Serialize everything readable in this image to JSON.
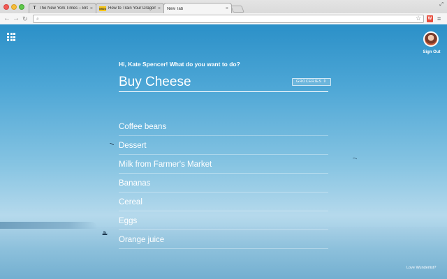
{
  "browser": {
    "tabs": [
      {
        "title": "The New York Times – Bre",
        "favicon": "T",
        "active": false
      },
      {
        "title": "How to Train Your Dragon",
        "favicon": "IMDb",
        "active": false
      },
      {
        "title": "New Tab",
        "favicon": "",
        "active": true
      }
    ],
    "address": {
      "value": ""
    },
    "extension_label": "W"
  },
  "app": {
    "greeting": "Hi, Kate Spencer! What do you want to do?",
    "task_input": {
      "value": "Buy Cheese"
    },
    "list_badge": "GROCERIES ⇕",
    "sign_out": "Sign Out",
    "footer_link": "Love Wunderlist?",
    "todos": [
      "Coffee beans",
      "Dessert",
      "Milk from Farmer's Market",
      "Bananas",
      "Cereal",
      "Eggs",
      "Orange juice"
    ]
  },
  "colors": {
    "sky_top": "#2b90c8",
    "sky_bottom": "#b5d9ec",
    "text": "#ffffff"
  }
}
